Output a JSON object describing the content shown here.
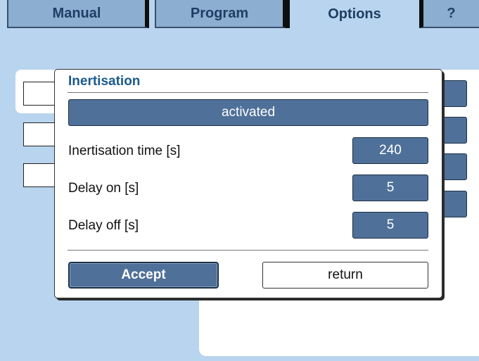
{
  "tabs": {
    "manual": "Manual",
    "program": "Program",
    "options": "Options",
    "help": "?"
  },
  "dialog": {
    "title": "Inertisation",
    "status": "activated",
    "rows": [
      {
        "label": "Inertisation time [s]",
        "value": "240"
      },
      {
        "label": "Delay on [s]",
        "value": "5"
      },
      {
        "label": "Delay off [s]",
        "value": "5"
      }
    ],
    "accept_label": "Accept",
    "return_label": "return"
  },
  "colors": {
    "background": "#b8d4ee",
    "accent": "#4f7099",
    "title": "#1b5a8c"
  }
}
